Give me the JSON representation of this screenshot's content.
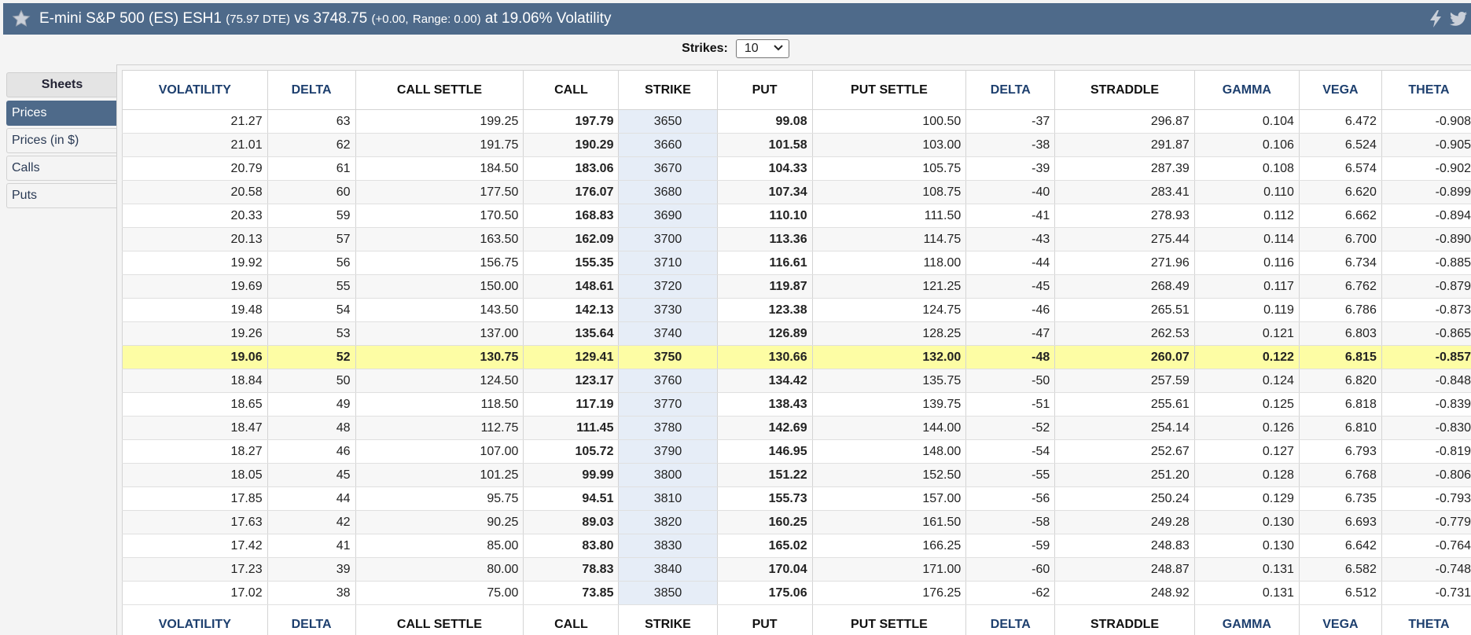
{
  "header": {
    "product": "E-mini S&P 500 (ES) ESH1",
    "dte": "(75.97 DTE)",
    "vs_label": "vs 3748.75",
    "change": "(+0.00,",
    "range": "Range: 0.00)",
    "suffix": "at 19.06% Volatility",
    "icons": [
      "star-icon",
      "lightning-icon",
      "twitter-icon"
    ]
  },
  "strikes": {
    "label": "Strikes:",
    "value": "10"
  },
  "sidebar": {
    "header": "Sheets",
    "items": [
      {
        "label": "Prices",
        "active": true
      },
      {
        "label": "Prices (in $)",
        "active": false
      },
      {
        "label": "Calls",
        "active": false
      },
      {
        "label": "Puts",
        "active": false
      }
    ]
  },
  "colors": {
    "header_bg": "#4e6a8a",
    "atm_row": "#fdfda4",
    "strike_col": "#e6edf7",
    "header_blue": "#1d3f6e"
  },
  "table": {
    "columns": [
      "VOLATILITY",
      "DELTA",
      "CALL SETTLE",
      "CALL",
      "STRIKE",
      "PUT",
      "PUT SETTLE",
      "DELTA",
      "STRADDLE",
      "GAMMA",
      "VEGA",
      "THETA"
    ],
    "blue_columns": [
      0,
      1,
      7,
      9,
      10,
      11
    ],
    "atm_index": 10,
    "rows": [
      [
        "21.27",
        "63",
        "199.25",
        "197.79",
        "3650",
        "99.08",
        "100.50",
        "-37",
        "296.87",
        "0.104",
        "6.472",
        "-0.908"
      ],
      [
        "21.01",
        "62",
        "191.75",
        "190.29",
        "3660",
        "101.58",
        "103.00",
        "-38",
        "291.87",
        "0.106",
        "6.524",
        "-0.905"
      ],
      [
        "20.79",
        "61",
        "184.50",
        "183.06",
        "3670",
        "104.33",
        "105.75",
        "-39",
        "287.39",
        "0.108",
        "6.574",
        "-0.902"
      ],
      [
        "20.58",
        "60",
        "177.50",
        "176.07",
        "3680",
        "107.34",
        "108.75",
        "-40",
        "283.41",
        "0.110",
        "6.620",
        "-0.899"
      ],
      [
        "20.33",
        "59",
        "170.50",
        "168.83",
        "3690",
        "110.10",
        "111.50",
        "-41",
        "278.93",
        "0.112",
        "6.662",
        "-0.894"
      ],
      [
        "20.13",
        "57",
        "163.50",
        "162.09",
        "3700",
        "113.36",
        "114.75",
        "-43",
        "275.44",
        "0.114",
        "6.700",
        "-0.890"
      ],
      [
        "19.92",
        "56",
        "156.75",
        "155.35",
        "3710",
        "116.61",
        "118.00",
        "-44",
        "271.96",
        "0.116",
        "6.734",
        "-0.885"
      ],
      [
        "19.69",
        "55",
        "150.00",
        "148.61",
        "3720",
        "119.87",
        "121.25",
        "-45",
        "268.49",
        "0.117",
        "6.762",
        "-0.879"
      ],
      [
        "19.48",
        "54",
        "143.50",
        "142.13",
        "3730",
        "123.38",
        "124.75",
        "-46",
        "265.51",
        "0.119",
        "6.786",
        "-0.873"
      ],
      [
        "19.26",
        "53",
        "137.00",
        "135.64",
        "3740",
        "126.89",
        "128.25",
        "-47",
        "262.53",
        "0.121",
        "6.803",
        "-0.865"
      ],
      [
        "19.06",
        "52",
        "130.75",
        "129.41",
        "3750",
        "130.66",
        "132.00",
        "-48",
        "260.07",
        "0.122",
        "6.815",
        "-0.857"
      ],
      [
        "18.84",
        "50",
        "124.50",
        "123.17",
        "3760",
        "134.42",
        "135.75",
        "-50",
        "257.59",
        "0.124",
        "6.820",
        "-0.848"
      ],
      [
        "18.65",
        "49",
        "118.50",
        "117.19",
        "3770",
        "138.43",
        "139.75",
        "-51",
        "255.61",
        "0.125",
        "6.818",
        "-0.839"
      ],
      [
        "18.47",
        "48",
        "112.75",
        "111.45",
        "3780",
        "142.69",
        "144.00",
        "-52",
        "254.14",
        "0.126",
        "6.810",
        "-0.830"
      ],
      [
        "18.27",
        "46",
        "107.00",
        "105.72",
        "3790",
        "146.95",
        "148.00",
        "-54",
        "252.67",
        "0.127",
        "6.793",
        "-0.819"
      ],
      [
        "18.05",
        "45",
        "101.25",
        "99.99",
        "3800",
        "151.22",
        "152.50",
        "-55",
        "251.20",
        "0.128",
        "6.768",
        "-0.806"
      ],
      [
        "17.85",
        "44",
        "95.75",
        "94.51",
        "3810",
        "155.73",
        "157.00",
        "-56",
        "250.24",
        "0.129",
        "6.735",
        "-0.793"
      ],
      [
        "17.63",
        "42",
        "90.25",
        "89.03",
        "3820",
        "160.25",
        "161.50",
        "-58",
        "249.28",
        "0.130",
        "6.693",
        "-0.779"
      ],
      [
        "17.42",
        "41",
        "85.00",
        "83.80",
        "3830",
        "165.02",
        "166.25",
        "-59",
        "248.83",
        "0.130",
        "6.642",
        "-0.764"
      ],
      [
        "17.23",
        "39",
        "80.00",
        "78.83",
        "3840",
        "170.04",
        "171.00",
        "-60",
        "248.87",
        "0.131",
        "6.582",
        "-0.748"
      ],
      [
        "17.02",
        "38",
        "75.00",
        "73.85",
        "3850",
        "175.06",
        "176.25",
        "-62",
        "248.92",
        "0.131",
        "6.512",
        "-0.731"
      ]
    ]
  }
}
